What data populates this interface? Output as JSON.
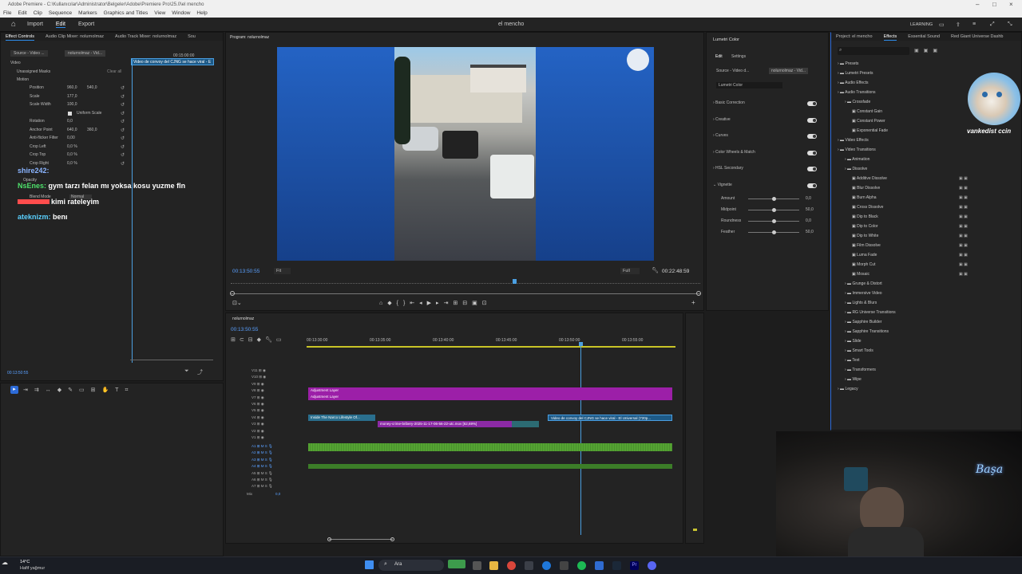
{
  "window": {
    "title": "Adobe Premiere - C:\\Kullanıcılar\\Administrator\\Belgeler\\Adobe\\Premiere Pro\\25.0\\el mencho"
  },
  "menu": [
    "File",
    "Edit",
    "Clip",
    "Sequence",
    "Markers",
    "Graphics and Titles",
    "View",
    "Window",
    "Help"
  ],
  "appbar": {
    "import": "Import",
    "edit": "Edit",
    "export": "Export",
    "project_name": "el mencho",
    "learning": "LEARNING"
  },
  "left_panel": {
    "tabs": [
      "Effect Controls",
      "Audio Clip Mixer: nolurnolmaz",
      "Audio Track Mixer: nolurnolmaz",
      "Sou"
    ],
    "source_label": "Source - Video ...",
    "seq_label": "nolurnolmaz - Vid...",
    "tl_time1": "00:15:00:00",
    "clip_name": "Video de convoy del CJNG se hace viral - E",
    "video": "Video",
    "unassigned": "Unassigned Masks",
    "clear": "Clear all",
    "motion": "Motion",
    "props": [
      {
        "name": "Position",
        "v1": "960,0",
        "v2": "540,0"
      },
      {
        "name": "Scale",
        "v1": "177,0",
        "v2": ""
      },
      {
        "name": "Scale Width",
        "v1": "100,0",
        "v2": ""
      },
      {
        "name": "Uniform Scale",
        "v1": "",
        "v2": ""
      },
      {
        "name": "Rotation",
        "v1": "0,0",
        "v2": ""
      },
      {
        "name": "Anchor Point",
        "v1": "640,0",
        "v2": "360,0"
      },
      {
        "name": "Anti-flicker Filter",
        "v1": "0,00",
        "v2": ""
      },
      {
        "name": "Crop Left",
        "v1": "0,0 %",
        "v2": ""
      },
      {
        "name": "Crop Top",
        "v1": "0,0 %",
        "v2": ""
      },
      {
        "name": "Crop Right",
        "v1": "0,0 %",
        "v2": ""
      }
    ],
    "opacity": "Opacity",
    "blend_mode": "Blend Mode",
    "blend_value": "Normal",
    "timecode": "00:13:50:55"
  },
  "chat": [
    {
      "user": "shire242:",
      "msg": "",
      "color": "#8ab4ff"
    },
    {
      "user": "NsEnes:",
      "msg": "gym tarzı felan mı yoksa kosu yuzme fln",
      "color": "#4ee06b"
    },
    {
      "user": "",
      "msg": "kimi rateleyim",
      "color": "#ff4d4d"
    },
    {
      "user": "ateknizm:",
      "msg": "benı",
      "color": "#5ad0ff"
    }
  ],
  "program": {
    "tab": "Program: nolurnolmaz",
    "timecode": "00:13:50:55",
    "fit": "Fit",
    "full": "Full",
    "duration": "00:22:48:59"
  },
  "lumetri": {
    "title": "Lumetri Color",
    "tabs": [
      "Edit",
      "Settings"
    ],
    "source": "Source - Video d...",
    "seq": "nolurnolmaz - Vid...",
    "effect": "Lumetri Color",
    "sections": [
      "Basic Correction",
      "Creative",
      "Curves",
      "Color Wheels & Match",
      "HSL Secondary",
      "Vignette"
    ],
    "vignette": [
      {
        "name": "Amount",
        "value": "0,0"
      },
      {
        "name": "Midpoint",
        "value": "50,0"
      },
      {
        "name": "Roundness",
        "value": "0,0"
      },
      {
        "name": "Feather",
        "value": "50,0"
      }
    ]
  },
  "effects": {
    "tabs": [
      "Project: el mencho",
      "Effects",
      "Essential Sound",
      "Red Giant Universe Dashb"
    ],
    "tree": [
      {
        "label": "Presets",
        "level": 0
      },
      {
        "label": "Lumetri Presets",
        "level": 0
      },
      {
        "label": "Audio Effects",
        "level": 0
      },
      {
        "label": "Audio Transitions",
        "level": 0
      },
      {
        "label": "Crossfade",
        "level": 1
      },
      {
        "label": "Constant Gain",
        "level": 2
      },
      {
        "label": "Constant Power",
        "level": 2
      },
      {
        "label": "Exponential Fade",
        "level": 2
      },
      {
        "label": "Video Effects",
        "level": 0
      },
      {
        "label": "Video Transitions",
        "level": 0
      },
      {
        "label": "Animation",
        "level": 1
      },
      {
        "label": "Dissolve",
        "level": 1
      },
      {
        "label": "Additive Dissolve",
        "level": 2
      },
      {
        "label": "Blur Dissolve",
        "level": 2
      },
      {
        "label": "Burn Alpha",
        "level": 2
      },
      {
        "label": "Cross Dissolve",
        "level": 2
      },
      {
        "label": "Dip to Black",
        "level": 2
      },
      {
        "label": "Dip to Color",
        "level": 2
      },
      {
        "label": "Dip to White",
        "level": 2
      },
      {
        "label": "Film Dissolve",
        "level": 2
      },
      {
        "label": "Luma Fade",
        "level": 2
      },
      {
        "label": "Morph Cut",
        "level": 2
      },
      {
        "label": "Mosaic",
        "level": 2
      },
      {
        "label": "Grunge & Distort",
        "level": 1
      },
      {
        "label": "Immersive Video",
        "level": 1
      },
      {
        "label": "Lights & Blurs",
        "level": 1
      },
      {
        "label": "RG Universe Transitions",
        "level": 1
      },
      {
        "label": "Sapphire Builder",
        "level": 1
      },
      {
        "label": "Sapphire Transitions",
        "level": 1
      },
      {
        "label": "Slide",
        "level": 1
      },
      {
        "label": "Smart Tools",
        "level": 1
      },
      {
        "label": "Text",
        "level": 1
      },
      {
        "label": "Transformers",
        "level": 1
      },
      {
        "label": "Wipe",
        "level": 1
      },
      {
        "label": "Legacy",
        "level": 0
      }
    ],
    "overlay_text": "vankedist ccin"
  },
  "timeline": {
    "seq_name": "nolurnolmaz",
    "timecode": "00:13:50:55",
    "ruler": [
      "00:13:30:00",
      "00:13:35:00",
      "00:13:40:00",
      "00:13:45:00",
      "00:13:50:00",
      "00:13:55:00"
    ],
    "video_tracks": [
      "V11",
      "V10",
      "V9",
      "V8",
      "V7",
      "V6",
      "V5",
      "V4",
      "V3",
      "V2",
      "V1"
    ],
    "audio_tracks": [
      "A1",
      "A2",
      "A3",
      "A4",
      "A5",
      "A6",
      "A7"
    ],
    "mix": "Mix",
    "mix_value": "0,0",
    "clips": {
      "adj1": "Adjustment Layer",
      "adj2": "Adjustment Layer",
      "narco": "Inside The Narco Lifestyle Of...",
      "money": "money-crime-bribery-2025-11-17-06-56-22-utc.mov [62,69%]",
      "cjng": "Video de convoy del CJNG se hace viral - El Universal (720p..."
    }
  },
  "taskbar": {
    "temp": "14°C",
    "weather": "Hafif yağmur",
    "search": "Ara"
  },
  "webcam": {
    "neon": "Başa"
  }
}
